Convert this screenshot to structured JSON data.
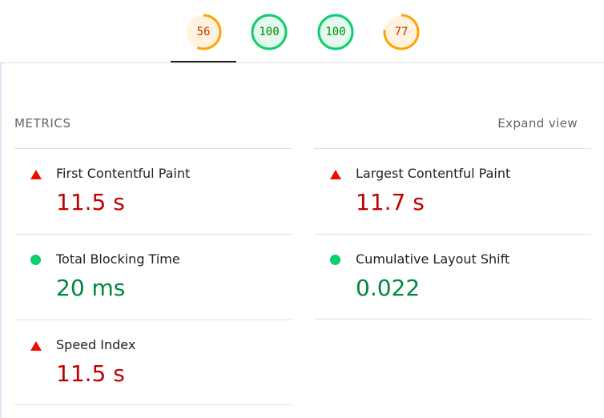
{
  "colors": {
    "fail": "#c00000",
    "pass": "#018642",
    "average_ring": "#ffa400",
    "pass_ring": "#0cce6b",
    "fail_icon": "#eb0f00"
  },
  "gauges": [
    {
      "value": "56",
      "score": 56,
      "rating": "average"
    },
    {
      "value": "100",
      "score": 100,
      "rating": "pass"
    },
    {
      "value": "100",
      "score": 100,
      "rating": "pass"
    },
    {
      "value": "77",
      "score": 77,
      "rating": "average"
    }
  ],
  "metrics_section": {
    "title": "METRICS",
    "expand_label": "Expand view"
  },
  "metrics": {
    "fcp": {
      "label": "First Contentful Paint",
      "value": "11.5 s",
      "status": "fail",
      "icon": "triangle-warning-icon"
    },
    "lcp": {
      "label": "Largest Contentful Paint",
      "value": "11.7 s",
      "status": "fail",
      "icon": "triangle-warning-icon"
    },
    "tbt": {
      "label": "Total Blocking Time",
      "value": "20 ms",
      "status": "pass",
      "icon": "circle-pass-icon"
    },
    "cls": {
      "label": "Cumulative Layout Shift",
      "value": "0.022",
      "status": "pass",
      "icon": "circle-pass-icon"
    },
    "si": {
      "label": "Speed Index",
      "value": "11.5 s",
      "status": "fail",
      "icon": "triangle-warning-icon"
    }
  }
}
